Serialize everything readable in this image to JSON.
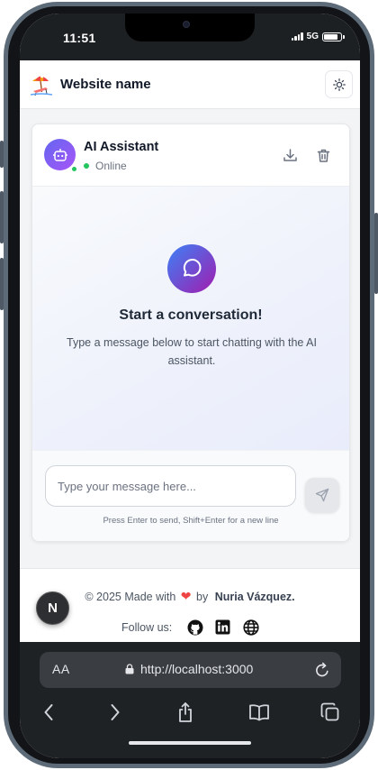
{
  "status_bar": {
    "time": "11:51",
    "network": "5G"
  },
  "header": {
    "site_name": "Website name"
  },
  "chat": {
    "bot_name": "AI Assistant",
    "status": "Online",
    "empty_title": "Start a conversation!",
    "empty_description": "Type a message below to start chatting with the AI assistant.",
    "input_placeholder": "Type your message here...",
    "hint": "Press Enter to send, Shift+Enter for a new line"
  },
  "footer": {
    "copyright_prefix": "© 2025 Made with",
    "by": "by",
    "author": "Nuria Vázquez.",
    "follow_label": "Follow us:"
  },
  "floating_avatar": {
    "initial": "N"
  },
  "browser": {
    "aa_label": "AA",
    "url": "http://localhost:3000"
  },
  "colors": {
    "accent_gradient_start": "#6366f1",
    "accent_gradient_end": "#a855f7",
    "online": "#22c55e",
    "heart": "#ef4444"
  },
  "icons": [
    "beach-logo-icon",
    "sun-icon",
    "robot-icon",
    "download-icon",
    "trash-icon",
    "chat-bubble-icon",
    "send-icon",
    "heart-icon",
    "github-icon",
    "linkedin-icon",
    "globe-icon",
    "lock-icon",
    "reload-icon",
    "back-icon",
    "forward-icon",
    "share-icon",
    "bookmarks-icon",
    "tabs-icon"
  ]
}
